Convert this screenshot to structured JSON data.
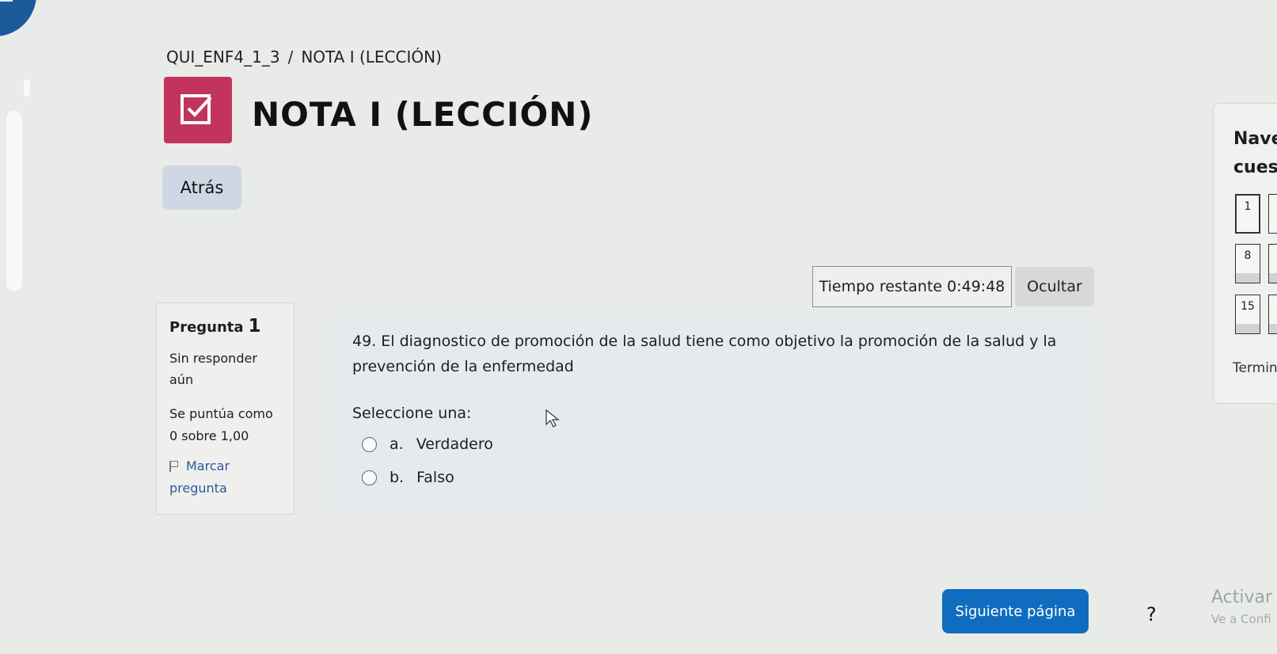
{
  "breadcrumb": {
    "course": "QUI_ENF4_1_3",
    "separator": "/",
    "current": "NOTA I (LECCIÓN)"
  },
  "activity": {
    "title": "NOTA I (LECCIÓN)",
    "icon": "assignment-check-icon",
    "icon_bg": "#c2335d"
  },
  "back_label": "Atrás",
  "timer": {
    "label": "Tiempo restante",
    "value": "0:49:48",
    "hide_label": "Ocultar"
  },
  "question_info": {
    "label": "Pregunta",
    "number": "1",
    "state_line1": "Sin responder",
    "state_line2": "aún",
    "grade_line1": "Se puntúa como",
    "grade_line2": "0 sobre 1,00",
    "flag_line1": "Marcar",
    "flag_line2": "pregunta"
  },
  "question": {
    "text": "49. El diagnostico de promoción de la salud tiene como objetivo la promoción de la salud y la prevención de la enfermedad",
    "prompt": "Seleccione una:",
    "options": [
      {
        "letter": "a.",
        "label": "Verdadero",
        "selected": false
      },
      {
        "letter": "b.",
        "label": "Falso",
        "selected": false
      }
    ]
  },
  "next_label": "Siguiente página",
  "help_label": "?",
  "watermark": {
    "line1": "Activar W",
    "line2": "Ve a Confi"
  },
  "nav": {
    "title_line1": "Nave",
    "title_line2": "cuest",
    "tiles": [
      "1",
      "8",
      "15"
    ],
    "finish": "Termin"
  },
  "colors": {
    "primary": "#0f6cbf",
    "back_button": "#cfd6e4",
    "page_bg": "#e9ebe9"
  }
}
